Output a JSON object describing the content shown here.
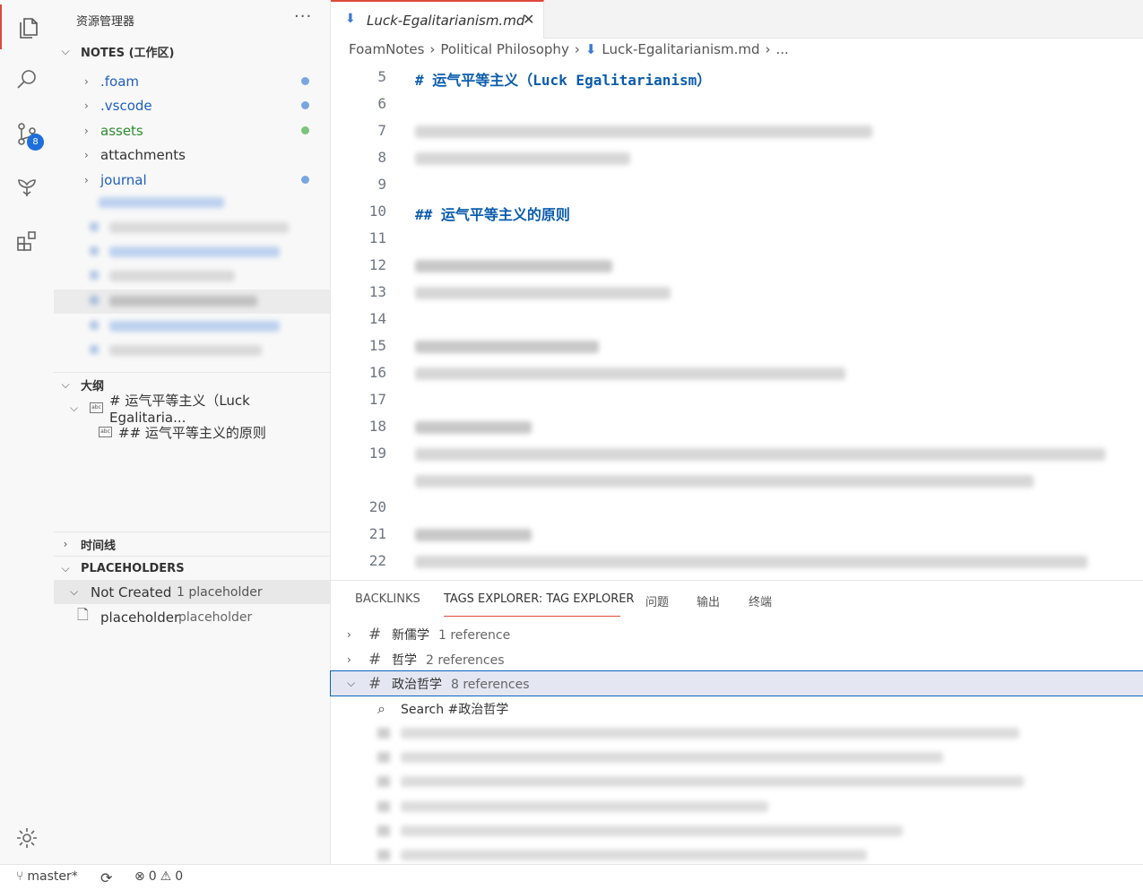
{
  "sidebar": {
    "title": "资源管理器",
    "more": "···",
    "notes_header": "NOTES (工作区)",
    "tree": [
      {
        "label": ".foam",
        "status_color": "#7aa6e0"
      },
      {
        "label": ".vscode",
        "status_color": "#7aa6e0"
      },
      {
        "label": "assets",
        "status_color": "#7cc47c"
      },
      {
        "label": "attachments"
      },
      {
        "label": "journal",
        "status_color": "#7aa6e0"
      }
    ],
    "outline_header": "大纲",
    "outline": [
      {
        "label": "# 运气平等主义（Luck Egalitaria..."
      },
      {
        "label": "## 运气平等主义的原则"
      }
    ],
    "timeline_header": "时间线",
    "placeholders_header": "PLACEHOLDERS",
    "not_created": {
      "label": "Not Created",
      "count": "1 placeholder"
    },
    "placeholder_item": {
      "label": "placeholder",
      "desc": "placeholder"
    }
  },
  "activity": {
    "source_control_badge": "8",
    "icons": [
      "files-icon",
      "search-icon",
      "source-control-icon",
      "foam-graph-icon",
      "extensions-icon",
      "settings-gear-icon"
    ]
  },
  "editor": {
    "tab_title": "Luck-Egalitarianism.md",
    "breadcrumb": [
      "FoamNotes",
      "Political Philosophy",
      "Luck-Egalitarianism.md",
      "..."
    ],
    "lines": [
      {
        "num": "5",
        "text": "# 运气平等主义（Luck Egalitarianism）",
        "style": "h1"
      },
      {
        "num": "6",
        "text": ""
      },
      {
        "num": "7",
        "text": "",
        "blurred": true
      },
      {
        "num": "8",
        "text": "",
        "blurred": true
      },
      {
        "num": "9",
        "text": ""
      },
      {
        "num": "10",
        "text": "## 运气平等主义的原则",
        "style": "h1"
      },
      {
        "num": "11",
        "text": ""
      },
      {
        "num": "12",
        "text": "",
        "blurred": true
      },
      {
        "num": "13",
        "text": "",
        "blurred": true
      },
      {
        "num": "14",
        "text": ""
      },
      {
        "num": "15",
        "text": "",
        "blurred": true
      },
      {
        "num": "16",
        "text": "",
        "blurred": true
      },
      {
        "num": "17",
        "text": ""
      },
      {
        "num": "18",
        "text": "",
        "blurred": true
      },
      {
        "num": "19",
        "text": "",
        "blurred": true
      },
      {
        "num": "20",
        "text": ""
      },
      {
        "num": "21",
        "text": "",
        "blurred": true
      },
      {
        "num": "22",
        "text": "",
        "blurred": true
      }
    ]
  },
  "panel": {
    "tabs": [
      "BACKLINKS",
      "TAGS EXPLORER: TAG EXPLORER",
      "问题",
      "输出",
      "终端"
    ],
    "tags": [
      {
        "name": "新儒学",
        "count": "1 reference"
      },
      {
        "name": "哲学",
        "count": "2 references"
      },
      {
        "name": "政治哲学",
        "count": "8 references"
      }
    ],
    "search_label": "Search #政治哲学"
  },
  "status": {
    "branch": "master*",
    "errors": "0",
    "warnings": "0"
  }
}
